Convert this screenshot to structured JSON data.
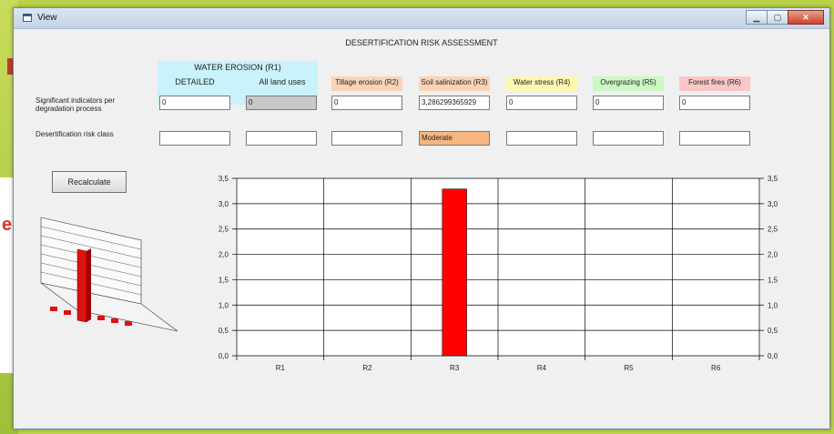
{
  "window": {
    "title": "View",
    "controls": [
      "minimize",
      "maximize",
      "close"
    ]
  },
  "heading": "DESERTIFICATION RISK ASSESSMENT",
  "water_erosion": {
    "title": "WATER EROSION (R1)",
    "detailed": "DETAILED",
    "all_land_uses": "All land uses"
  },
  "columns": [
    {
      "id": "r1_detailed",
      "header": "",
      "color": "",
      "indicator": "0",
      "risk": ""
    },
    {
      "id": "r1_all",
      "header": "",
      "color": "",
      "indicator": "0",
      "risk": ""
    },
    {
      "id": "r2",
      "header": "Tillage erosion (R2)",
      "color": "#fcd3b6",
      "indicator": "0",
      "risk": ""
    },
    {
      "id": "r3",
      "header": "Soil salinization (R3)",
      "color": "#fcd3b6",
      "indicator": "3,286299365929",
      "risk": "Moderate"
    },
    {
      "id": "r4",
      "header": "Water stress (R4)",
      "color": "#fdf7b0",
      "indicator": "0",
      "risk": ""
    },
    {
      "id": "r5",
      "header": "Overgrazing (R5)",
      "color": "#ccf8c4",
      "indicator": "0",
      "risk": ""
    },
    {
      "id": "r6",
      "header": "Forest fires (R6)",
      "color": "#fcc6c6",
      "indicator": "0",
      "risk": ""
    }
  ],
  "labels": {
    "indicators": "Significant indicators per degradation process",
    "risk_class": "Desertification risk class"
  },
  "buttons": {
    "recalculate": "Recalculate"
  },
  "chart_data": {
    "type": "bar",
    "categories": [
      "R1",
      "R2",
      "R3",
      "R4",
      "R5",
      "R6"
    ],
    "values": [
      0,
      0,
      3.29,
      0,
      0,
      0
    ],
    "ylim": [
      0,
      3.5
    ],
    "yticks": [
      "0,0",
      "0,5",
      "1,0",
      "1,5",
      "2,0",
      "2,5",
      "3,0",
      "3,5"
    ],
    "bar_color": "#ff0000",
    "grid": true,
    "title": "",
    "xlabel": "",
    "ylabel": ""
  }
}
